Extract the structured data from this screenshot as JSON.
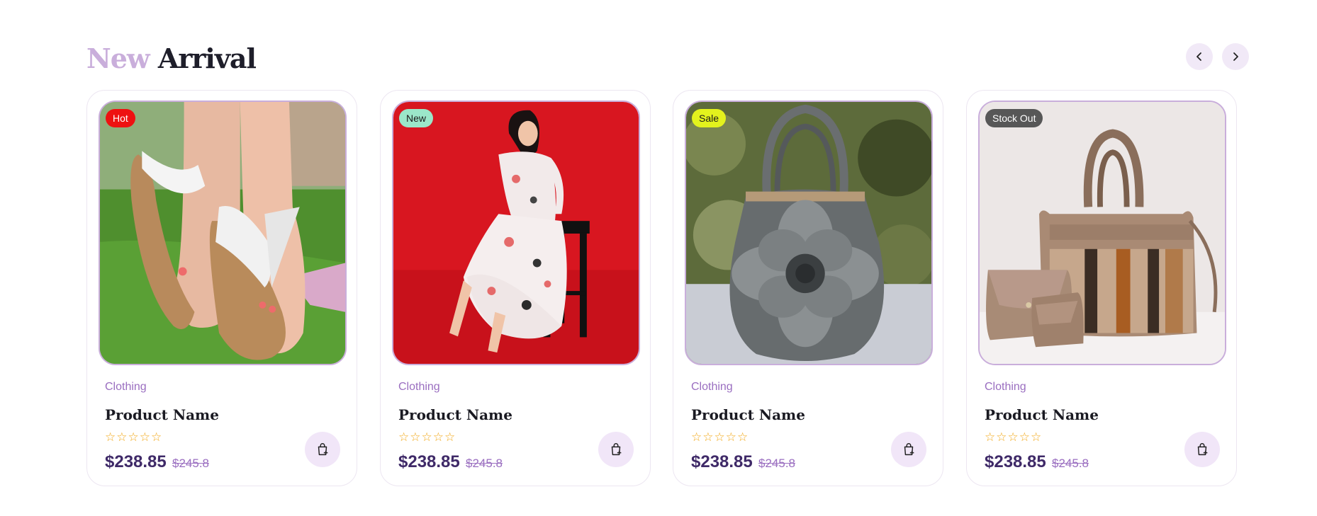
{
  "section": {
    "heading_accent": "New",
    "heading_main": "Arrival"
  },
  "nav": {
    "prev_icon": "chevron-left-icon",
    "next_icon": "chevron-right-icon"
  },
  "colors": {
    "accent": "#c9aedb",
    "price": "#3f2a68",
    "category": "#9a6ec0",
    "star": "#f2a91b"
  },
  "products": [
    {
      "badge": "Hot",
      "badge_bg": "#ee1111",
      "badge_color": "#ffffff",
      "image": "sandals-photo",
      "category": "Clothing",
      "name": "Product Name",
      "stars": "☆☆☆☆☆",
      "price": "$238.85",
      "old_price": "$245.8"
    },
    {
      "badge": "New",
      "badge_bg": "#9be7c9",
      "badge_color": "#1a1a1a",
      "image": "dress-photo",
      "category": "Clothing",
      "name": "Product Name",
      "stars": "☆☆☆☆☆",
      "price": "$238.85",
      "old_price": "$245.8"
    },
    {
      "badge": "Sale",
      "badge_bg": "#e3f21d",
      "badge_color": "#1a1a1a",
      "image": "flower-handbag-photo",
      "category": "Clothing",
      "name": "Product Name",
      "stars": "☆☆☆☆☆",
      "price": "$238.85",
      "old_price": "$245.8"
    },
    {
      "badge": "Stock Out",
      "badge_bg": "#575757",
      "badge_color": "#ffffff",
      "image": "handbag-set-photo",
      "category": "Clothing",
      "name": "Product Name",
      "stars": "☆☆☆☆☆",
      "price": "$238.85",
      "old_price": "$245.8"
    }
  ]
}
